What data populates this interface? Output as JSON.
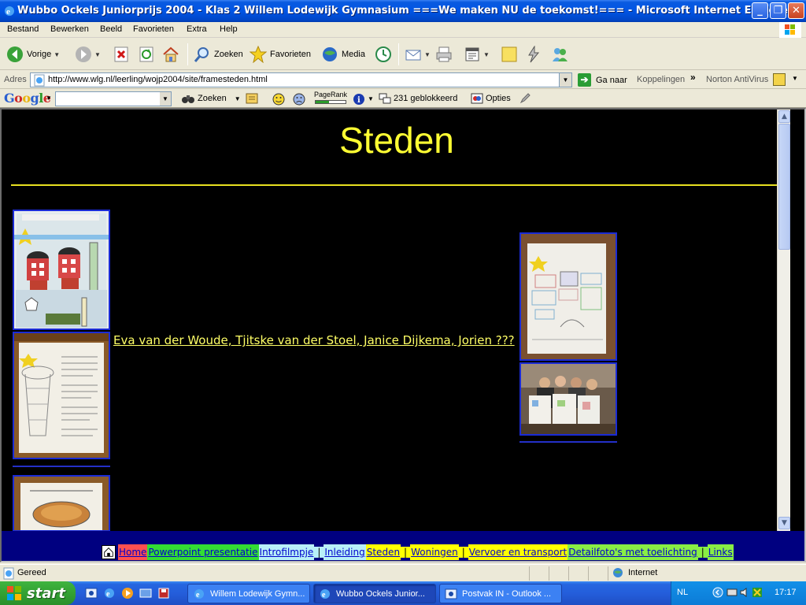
{
  "window": {
    "title": "Wubbo Ockels Juniorprijs 2004 - Klas 2 Willem Lodewijk Gymnasium ===We maken NU de toekomst!=== - Microsoft Internet Explorer"
  },
  "menubar": [
    "Bestand",
    "Bewerken",
    "Beeld",
    "Favorieten",
    "Extra",
    "Help"
  ],
  "toolbar": {
    "back": "Vorige",
    "search": "Zoeken",
    "favorites": "Favorieten",
    "media": "Media"
  },
  "addressbar": {
    "label": "Adres",
    "url": "http://www.wlg.nl/leerling/wojp2004/site/framesteden.html",
    "go": "Ga naar",
    "links": "Koppelingen",
    "norton": "Norton AntiVirus"
  },
  "googlebar": {
    "logo": "Google",
    "search": "Zoeken",
    "pagerank": "PageRank",
    "blocked": "231 geblokkeerd",
    "options": "Opties"
  },
  "page": {
    "heading": "Steden",
    "authors_link": "Eva van der Woude, Tjitske van der Stoel, Janice Dijkema, Jorien ???"
  },
  "nav": {
    "items": [
      {
        "label": "Home",
        "bg": "#ff5050",
        "fg": "#0000cc"
      },
      {
        "label": "Powerpoint presentatie",
        "bg": "#33dd33",
        "fg": "#0000cc"
      },
      {
        "label": "Introfilmpje",
        "bg": "#b8f0f8",
        "fg": "#0000cc"
      },
      {
        "label": "Inleiding",
        "bg": "#b8f0f8",
        "fg": "#0000cc"
      },
      {
        "label": "Steden",
        "bg": "#ffff00",
        "fg": "#0000cc"
      },
      {
        "label": "Woningen",
        "bg": "#ffff00",
        "fg": "#0000cc"
      },
      {
        "label": "Vervoer en transport",
        "bg": "#ffff00",
        "fg": "#0000cc"
      },
      {
        "label": "Detailfoto's met toelichting",
        "bg": "#88ee44",
        "fg": "#0000cc"
      },
      {
        "label": "Links",
        "bg": "#88ee44",
        "fg": "#0000cc"
      }
    ],
    "separator": "|"
  },
  "statusbar": {
    "text": "Gereed",
    "zone": "Internet"
  },
  "taskbar": {
    "start": "start",
    "tasks": [
      "Willem Lodewijk Gymn...",
      "Wubbo Ockels Junior...",
      "Postvak IN - Outlook ..."
    ],
    "lang": "NL",
    "clock": "17:17"
  },
  "colors": {
    "heading": "#ffff33",
    "page_bg": "#000000",
    "nav_bg": "#000080",
    "photo_border": "#1a2bd6"
  }
}
